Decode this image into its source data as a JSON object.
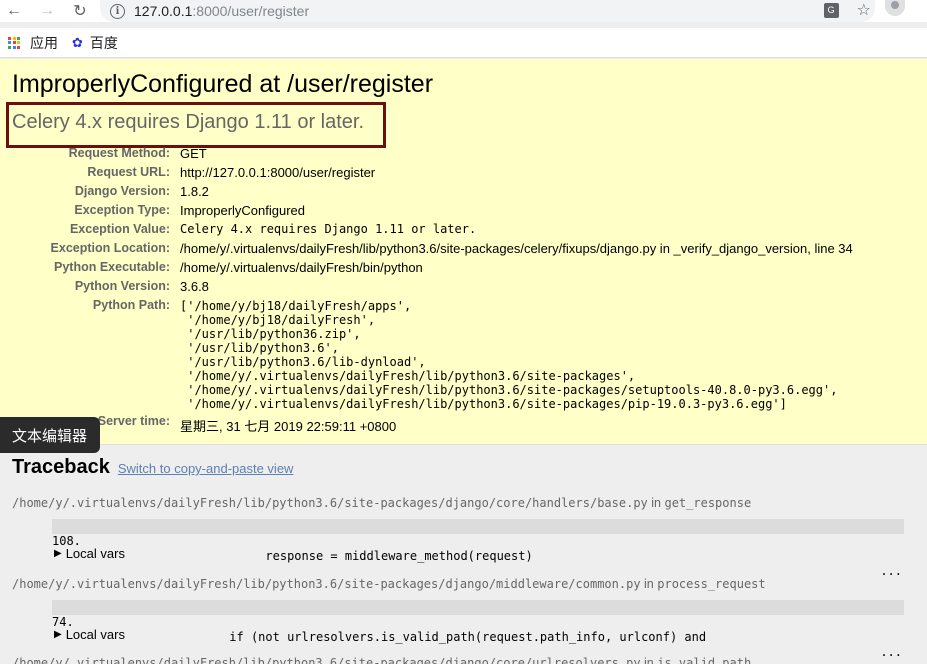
{
  "browser": {
    "url_host": "127.0.0.1",
    "url_rest": ":8000/user/register",
    "bookmarks": [
      {
        "label": "应用",
        "icon": "apps-grid-icon"
      },
      {
        "label": "百度",
        "icon": "baidu-paw-icon"
      }
    ]
  },
  "error": {
    "title": "ImproperlyConfigured at /user/register",
    "value": "Celery 4.x requires Django 1.11 or later."
  },
  "meta": [
    {
      "key": "Request Method:",
      "value": "GET"
    },
    {
      "key": "Request URL:",
      "value": "http://127.0.0.1:8000/user/register"
    },
    {
      "key": "Django Version:",
      "value": "1.8.2"
    },
    {
      "key": "Exception Type:",
      "value": "ImproperlyConfigured"
    },
    {
      "key": "Exception Value:",
      "value": "Celery 4.x requires Django 1.11 or later."
    },
    {
      "key": "Exception Location:",
      "value": "/home/y/.virtualenvs/dailyFresh/lib/python3.6/site-packages/celery/fixups/django.py in _verify_django_version, line 34"
    },
    {
      "key": "Python Executable:",
      "value": "/home/y/.virtualenvs/dailyFresh/bin/python"
    },
    {
      "key": "Python Version:",
      "value": "3.6.8"
    },
    {
      "key": "Python Path:",
      "value": ""
    }
  ],
  "python_path": [
    "['/home/y/bj18/dailyFresh/apps',",
    " '/home/y/bj18/dailyFresh',",
    " '/usr/lib/python36.zip',",
    " '/usr/lib/python3.6',",
    " '/usr/lib/python3.6/lib-dynload',",
    " '/home/y/.virtualenvs/dailyFresh/lib/python3.6/site-packages',",
    " '/home/y/.virtualenvs/dailyFresh/lib/python3.6/site-packages/setuptools-40.8.0-py3.6.egg',",
    " '/home/y/.virtualenvs/dailyFresh/lib/python3.6/site-packages/pip-19.0.3-py3.6.egg']"
  ],
  "server_time": {
    "key": "Server time:",
    "value": "星期三, 31 七月 2019 22:59:11 +0800"
  },
  "tooltip": "文本编辑器",
  "traceback": {
    "title": "Traceback",
    "switch_link": "Switch to copy-and-paste view",
    "local_vars_label": "Local vars",
    "frames": [
      {
        "file": "/home/y/.virtualenvs/dailyFresh/lib/python3.6/site-packages/django/core/handlers/base.py",
        "in_word": "in",
        "func": "get_response",
        "line_no": "108.",
        "code": "                        response = middleware_method(request)",
        "dots": "..."
      },
      {
        "file": "/home/y/.virtualenvs/dailyFresh/lib/python3.6/site-packages/django/middleware/common.py",
        "in_word": "in",
        "func": "process_request",
        "line_no": "74.",
        "code": "                   if (not urlresolvers.is_valid_path(request.path_info, urlconf) and",
        "dots": "..."
      },
      {
        "file": "/home/y/.virtualenvs/dailyFresh/lib/python3.6/site-packages/django/core/urlresolvers.py",
        "in_word": "in",
        "func": "is_valid_path",
        "line_no": "",
        "code": "",
        "dots": ""
      }
    ]
  }
}
